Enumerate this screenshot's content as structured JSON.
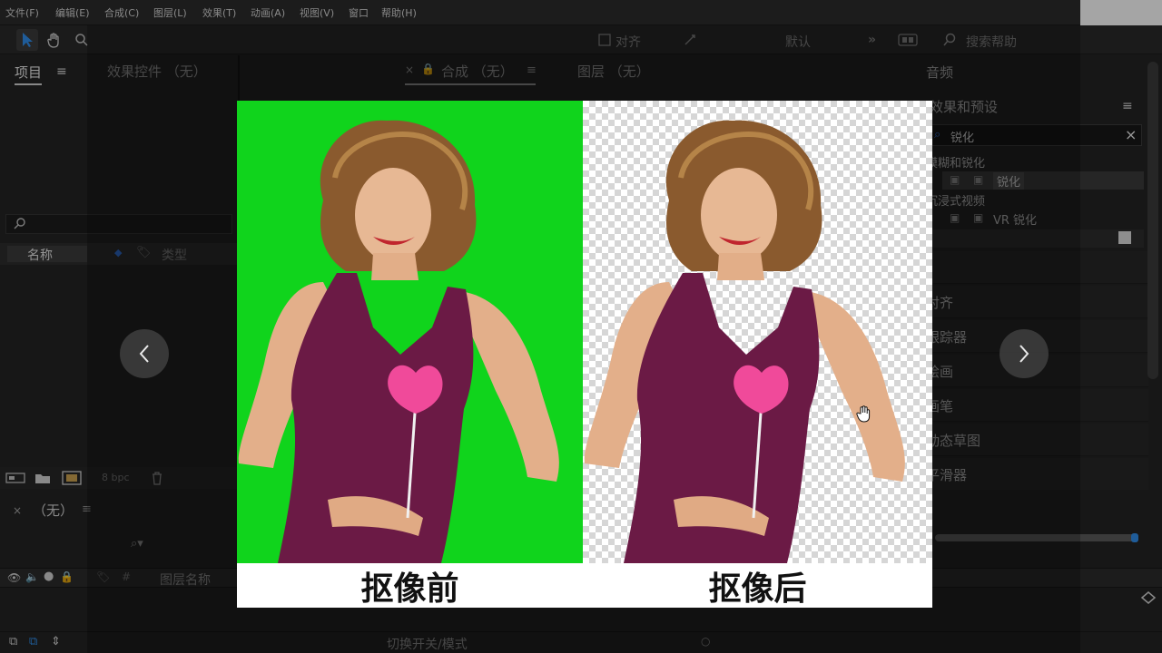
{
  "menu": [
    "文件(F)",
    "编辑(E)",
    "合成(C)",
    "图层(L)",
    "效果(T)",
    "动画(A)",
    "视图(V)",
    "窗口",
    "帮助(H)"
  ],
  "toolbar": {
    "snap_label": "对齐",
    "workspace_label": "默认",
    "search_help": "搜索帮助"
  },
  "project": {
    "tab_label": "项目",
    "col_name": "名称",
    "col_type": "类型",
    "bpc": "8 bpc"
  },
  "effect_controls": {
    "tab_label": "效果控件 （无）"
  },
  "composition": {
    "tab_label": "合成 （无）"
  },
  "layer": {
    "tab_label": "图层 （无）"
  },
  "right": {
    "audio_tab": "音频",
    "effects_presets": "效果和预设",
    "search_value": "锐化",
    "tree": [
      {
        "label": "模糊和锐化",
        "child": "锐化"
      },
      {
        "label": "沉浸式视频",
        "child": "VR 锐化"
      }
    ],
    "panels": [
      "对齐",
      "跟踪器",
      "绘画",
      "画笔",
      "动态草图",
      "平滑器"
    ]
  },
  "timeline": {
    "comp_tab": "（无）",
    "layer_name_col": "图层名称",
    "switches_mode": "切换开关/模式"
  },
  "image": {
    "caption_before": "抠像前",
    "caption_after": "抠像后",
    "left_bg": "#10d41c"
  }
}
